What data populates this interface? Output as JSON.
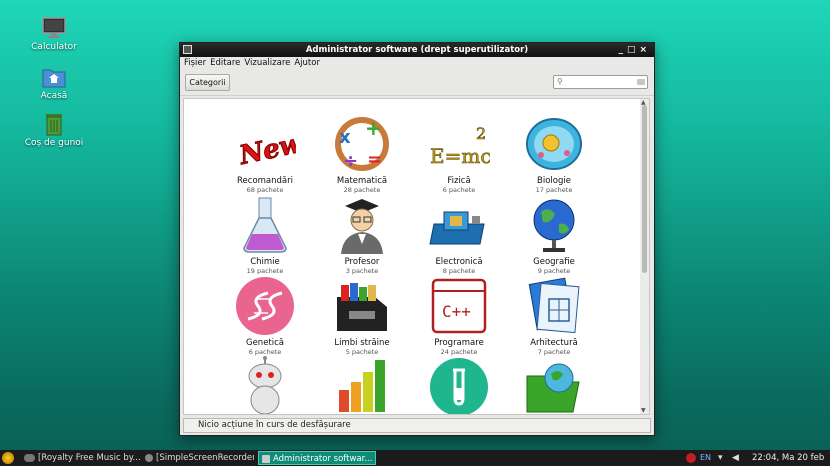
{
  "desktop": {
    "icons": [
      {
        "label": "Calculator",
        "icon": "monitor-icon"
      },
      {
        "label": "Acasă",
        "icon": "home-folder-icon"
      },
      {
        "label": "Coș de gunoi",
        "icon": "trash-icon"
      }
    ]
  },
  "window": {
    "title": "Administrator software (drept superutilizator)",
    "controls": [
      "_",
      "□",
      "×"
    ],
    "menu": [
      "Fișier",
      "Editare",
      "Vizualizare",
      "Ajutor"
    ],
    "categories_button": "Categorii",
    "search": {
      "value": "",
      "placeholder": ""
    },
    "status": "Nicio acțiune în curs de desfășurare"
  },
  "categories": [
    {
      "label": "Recomandări",
      "count": "68 pachete",
      "icon": "new-badge-icon"
    },
    {
      "label": "Matematică",
      "count": "28 pachete",
      "icon": "math-symbols-icon"
    },
    {
      "label": "Fizică",
      "count": "6 pachete",
      "icon": "emc2-icon"
    },
    {
      "label": "Biologie",
      "count": "17 pachete",
      "icon": "cell-icon"
    },
    {
      "label": "Chimie",
      "count": "19 pachete",
      "icon": "flask-icon"
    },
    {
      "label": "Profesor",
      "count": "3 pachete",
      "icon": "professor-icon"
    },
    {
      "label": "Electronică",
      "count": "8 pachete",
      "icon": "circuit-board-icon"
    },
    {
      "label": "Geografie",
      "count": "9 pachete",
      "icon": "globe-icon"
    },
    {
      "label": "Genetică",
      "count": "6 pachete",
      "icon": "dna-icon"
    },
    {
      "label": "Limbi străine",
      "count": "5 pachete",
      "icon": "file-box-icon"
    },
    {
      "label": "Programare",
      "count": "24 pachete",
      "icon": "cpp-icon"
    },
    {
      "label": "Arhitectură",
      "count": "7 pachete",
      "icon": "architecture-icon"
    },
    {
      "label": "",
      "count": "",
      "icon": "robot-icon"
    },
    {
      "label": "",
      "count": "",
      "icon": "bar-chart-icon"
    },
    {
      "label": "",
      "count": "",
      "icon": "test-tube-icon"
    },
    {
      "label": "",
      "count": "",
      "icon": "globe-folder-icon"
    }
  ],
  "taskbar": {
    "tasks": [
      {
        "label": "[Royalty Free Music by...",
        "active": false
      },
      {
        "label": "[SimpleScreenRecorder]",
        "active": false
      },
      {
        "label": "Administrator softwar...",
        "active": true
      }
    ],
    "language": "EN",
    "clock": "22:04, Ma 20 feb"
  },
  "colors": {
    "accent": "#0e8c77",
    "titlebar": "#111111",
    "desktop": "#14b59c"
  }
}
